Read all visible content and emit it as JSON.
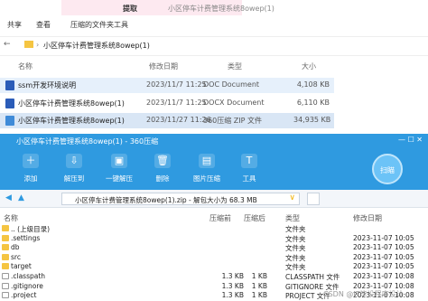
{
  "explorer": {
    "tabs": [
      "共享",
      "查看"
    ],
    "context_tab": "提取",
    "context_sub": "压缩的文件夹工具",
    "window_title": "小区停车计费管理系统8owep(1)",
    "address": "小区停车计费管理系统8owep(1)",
    "columns": [
      "名称",
      "修改日期",
      "类型",
      "大小"
    ],
    "files": [
      {
        "name": "ssm开发环境说明",
        "date": "2023/11/7 11:25",
        "type": "DOC Document",
        "size": "4,108 KB",
        "icon": "word-icon"
      },
      {
        "name": "小区停车计费管理系统8owep(1)",
        "date": "2023/11/7 11:25",
        "type": "DOCX Document",
        "size": "6,110 KB",
        "icon": "word-icon"
      },
      {
        "name": "小区停车计费管理系统8owep(1)",
        "date": "2023/11/27 11:26",
        "type": "360压缩 ZIP 文件",
        "size": "34,935 KB",
        "icon": "zip-icon"
      }
    ]
  },
  "zip": {
    "title": "小区停车计费管理系统8owep(1) - 360压缩",
    "toolbar": [
      "添加",
      "解压到",
      "一键解压",
      "删除",
      "图片压缩",
      "工具"
    ],
    "scan_label": "扫瞄",
    "path": "小区停车计费管理系统8owep(1).zip - 解包大小为 68.3 MB",
    "columns": [
      "名称",
      "压缩前",
      "压缩后",
      "类型",
      "修改日期"
    ],
    "rows": [
      {
        "name": ".. (上级目录)",
        "before": "",
        "after": "",
        "type": "文件夹",
        "date": "",
        "kind": "folder"
      },
      {
        "name": ".settings",
        "before": "",
        "after": "",
        "type": "文件夹",
        "date": "2023-11-07 10:05",
        "kind": "folder"
      },
      {
        "name": "db",
        "before": "",
        "after": "",
        "type": "文件夹",
        "date": "2023-11-07 10:05",
        "kind": "folder"
      },
      {
        "name": "src",
        "before": "",
        "after": "",
        "type": "文件夹",
        "date": "2023-11-07 10:05",
        "kind": "folder"
      },
      {
        "name": "target",
        "before": "",
        "after": "",
        "type": "文件夹",
        "date": "2023-11-07 10:05",
        "kind": "folder"
      },
      {
        "name": ".classpath",
        "before": "1.3 KB",
        "after": "1 KB",
        "type": "CLASSPATH 文件",
        "date": "2023-11-07 10:08",
        "kind": "file"
      },
      {
        "name": ".gitignore",
        "before": "1.3 KB",
        "after": "1 KB",
        "type": "GITIGNORE 文件",
        "date": "2023-11-07 10:08",
        "kind": "file"
      },
      {
        "name": ".project",
        "before": "1.3 KB",
        "after": "1 KB",
        "type": "PROJECT 文件",
        "date": "2023-11-07 10:08",
        "kind": "file"
      }
    ],
    "watermark": "CSDN @IT毕设程序设计"
  }
}
